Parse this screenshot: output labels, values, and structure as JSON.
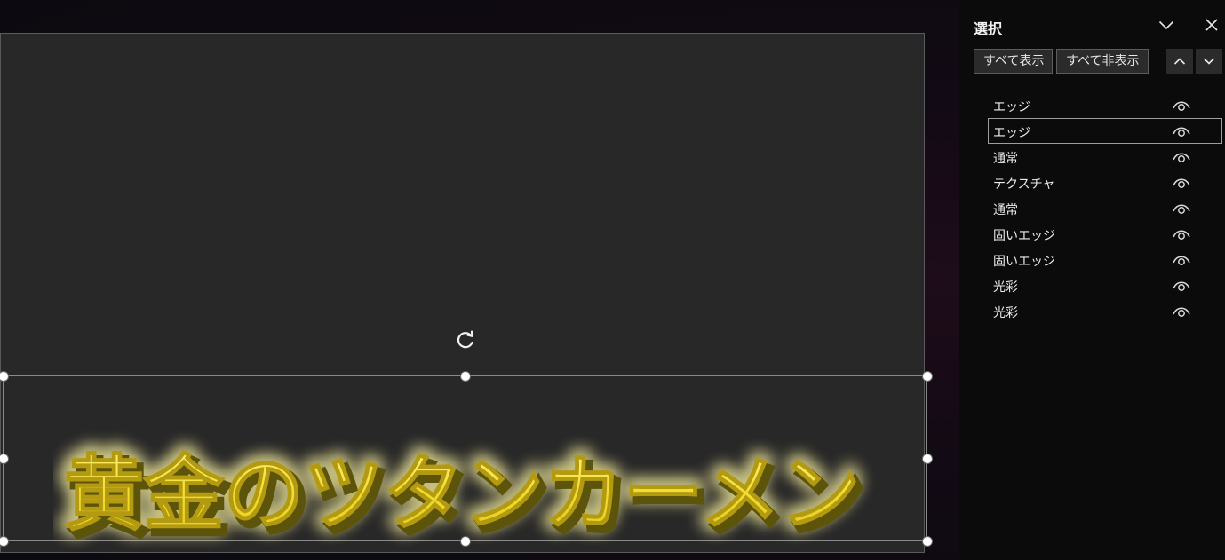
{
  "canvas": {
    "headline": "黄金のツタンカーメン"
  },
  "panel": {
    "title": "選択",
    "show_all_label": "すべて表示",
    "hide_all_label": "すべて非表示",
    "icons": {
      "collapse": "chevron-down-icon",
      "close": "close-icon",
      "bring_forward": "chevron-up-icon",
      "send_backward": "chevron-down-icon",
      "visibility": "eye-icon"
    },
    "layers": [
      {
        "label": "エッジ",
        "visible": true,
        "selected": false
      },
      {
        "label": "エッジ",
        "visible": true,
        "selected": true
      },
      {
        "label": "通常",
        "visible": true,
        "selected": false
      },
      {
        "label": "テクスチャ",
        "visible": true,
        "selected": false
      },
      {
        "label": "通常",
        "visible": true,
        "selected": false
      },
      {
        "label": "固いエッジ",
        "visible": true,
        "selected": false
      },
      {
        "label": "固いエッジ",
        "visible": true,
        "selected": false
      },
      {
        "label": "光彩",
        "visible": true,
        "selected": false
      },
      {
        "label": "光彩",
        "visible": true,
        "selected": false
      }
    ]
  },
  "colors": {
    "gold_text": "#f2e23a",
    "gold_shadow": "#6e6410",
    "glow": "#fff6a0"
  }
}
